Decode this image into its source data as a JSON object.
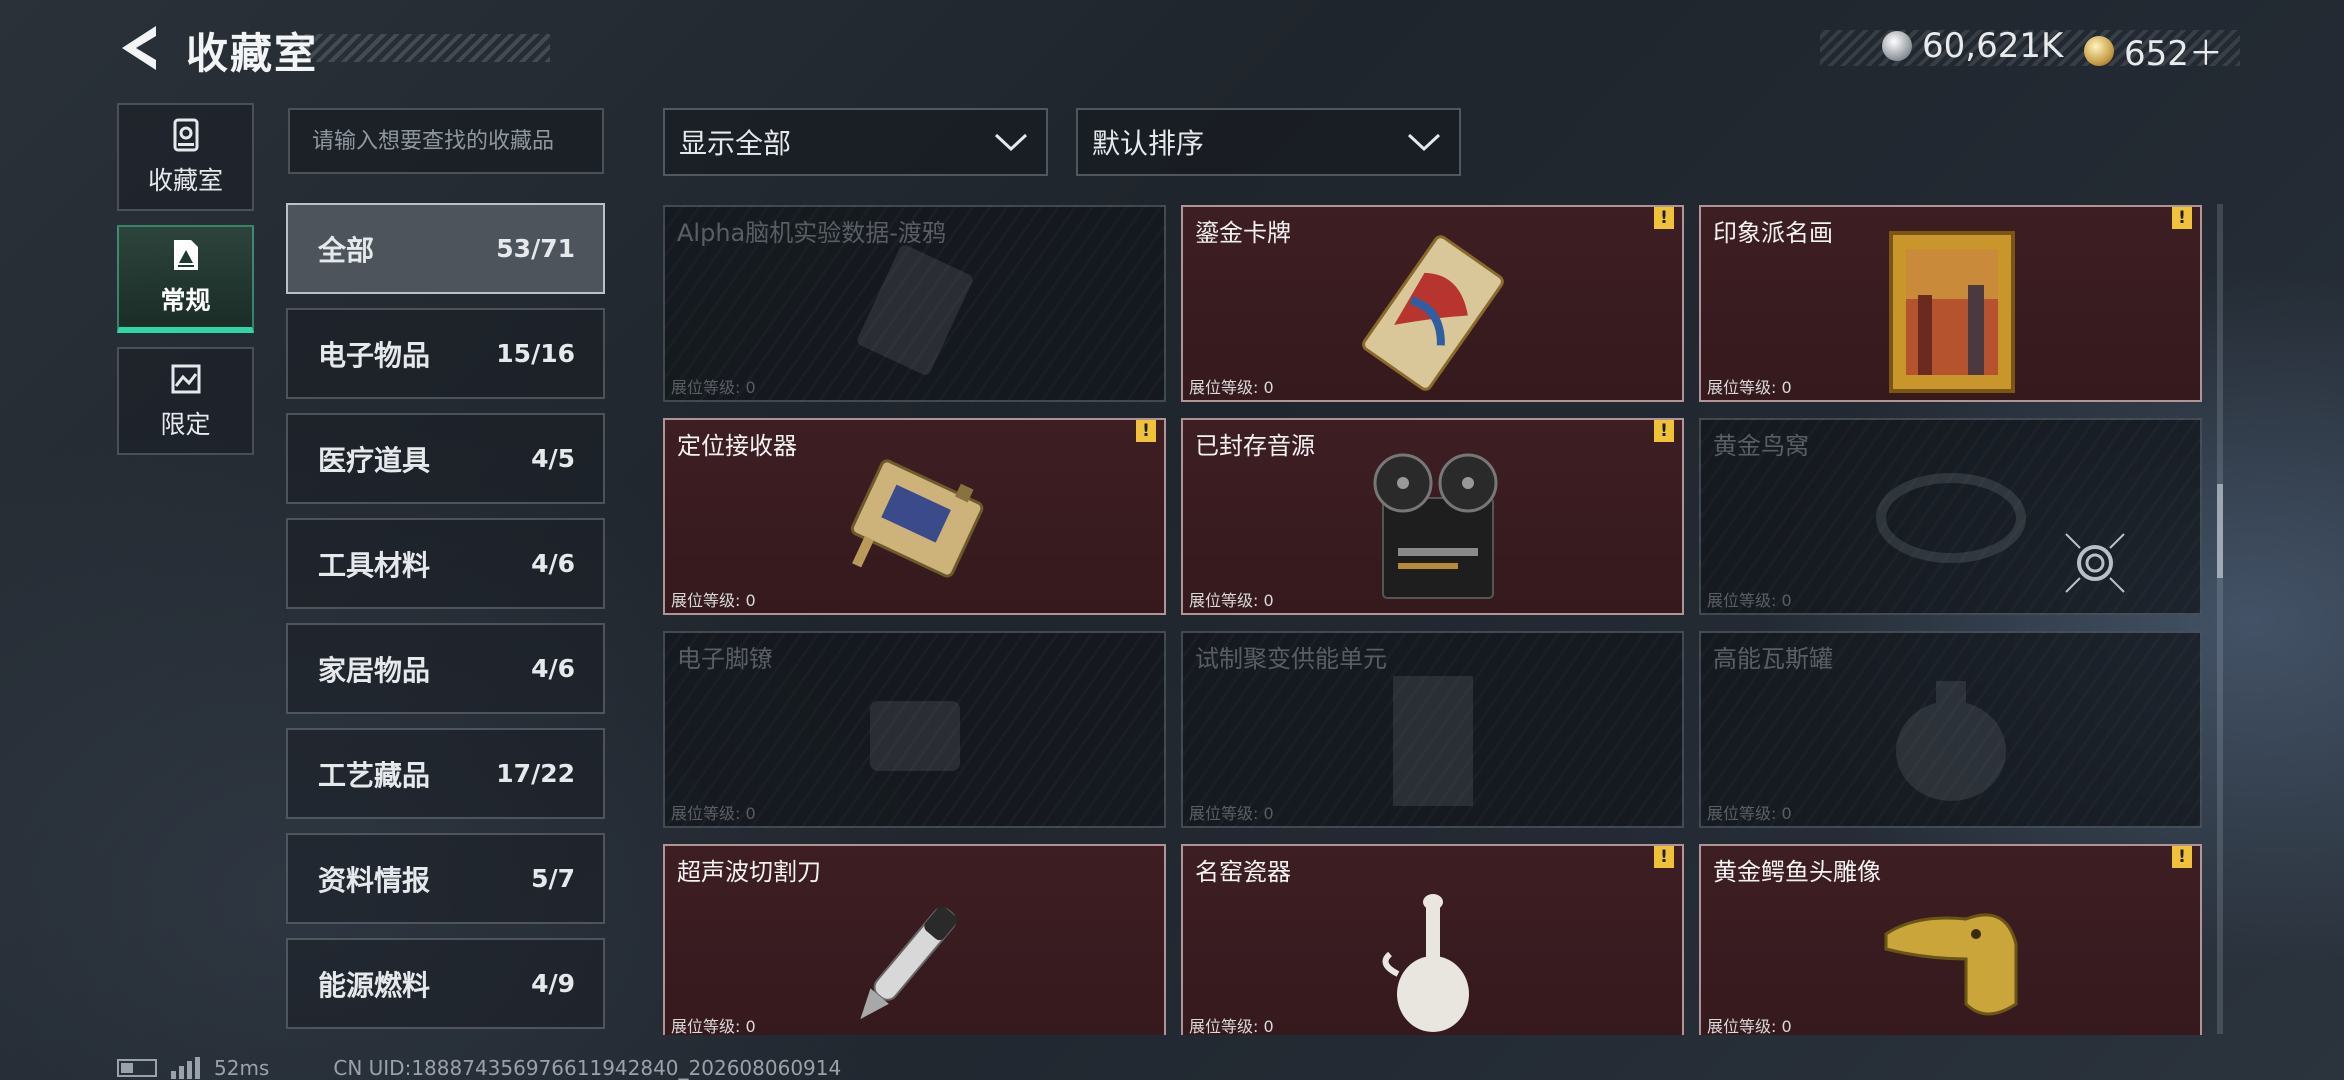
{
  "header": {
    "title": "收藏室",
    "currency_silver": "60,621K",
    "currency_gold": "652＋"
  },
  "side_nav": [
    {
      "label": "收藏室",
      "icon": "vault-icon",
      "active": false
    },
    {
      "label": "常规",
      "icon": "document-icon",
      "active": true
    },
    {
      "label": "限定",
      "icon": "picture-icon",
      "active": false
    }
  ],
  "search": {
    "placeholder": "请输入想要查找的收藏品",
    "value": ""
  },
  "categories": [
    {
      "name": "全部",
      "count": "53/71",
      "active": true
    },
    {
      "name": "电子物品",
      "count": "15/16"
    },
    {
      "name": "医疗道具",
      "count": "4/5"
    },
    {
      "name": "工具材料",
      "count": "4/6"
    },
    {
      "name": "家居物品",
      "count": "4/6"
    },
    {
      "name": "工艺藏品",
      "count": "17/22"
    },
    {
      "name": "资料情报",
      "count": "5/7"
    },
    {
      "name": "能源燃料",
      "count": "4/9"
    }
  ],
  "filters": {
    "display": "显示全部",
    "sort": "默认排序"
  },
  "level_label": "展位等级: 0",
  "badge_text": "!",
  "items": [
    {
      "name": "Alpha脑机实验数据-渡鸦",
      "owned": false,
      "new": false,
      "art": "data-drive"
    },
    {
      "name": "鎏金卡牌",
      "owned": true,
      "new": true,
      "art": "card"
    },
    {
      "name": "印象派名画",
      "owned": true,
      "new": true,
      "art": "painting"
    },
    {
      "name": "定位接收器",
      "owned": true,
      "new": true,
      "art": "receiver"
    },
    {
      "name": "已封存音源",
      "owned": true,
      "new": true,
      "art": "tape-recorder"
    },
    {
      "name": "黄金鸟窝",
      "owned": false,
      "new": false,
      "art": "nest",
      "target": true
    },
    {
      "name": "电子脚镣",
      "owned": false,
      "new": false,
      "art": "shackle"
    },
    {
      "name": "试制聚变供能单元",
      "owned": false,
      "new": false,
      "art": "fusion-unit"
    },
    {
      "name": "高能瓦斯罐",
      "owned": false,
      "new": false,
      "art": "gas-canister"
    },
    {
      "name": "超声波切割刀",
      "owned": true,
      "new": false,
      "art": "knife"
    },
    {
      "name": "名窑瓷器",
      "owned": true,
      "new": true,
      "art": "porcelain"
    },
    {
      "name": "黄金鳄鱼头雕像",
      "owned": true,
      "new": true,
      "art": "croc-head"
    }
  ],
  "footer": {
    "ping": "52ms",
    "uid": "CN UID:188874356976611942840_202608060914"
  }
}
